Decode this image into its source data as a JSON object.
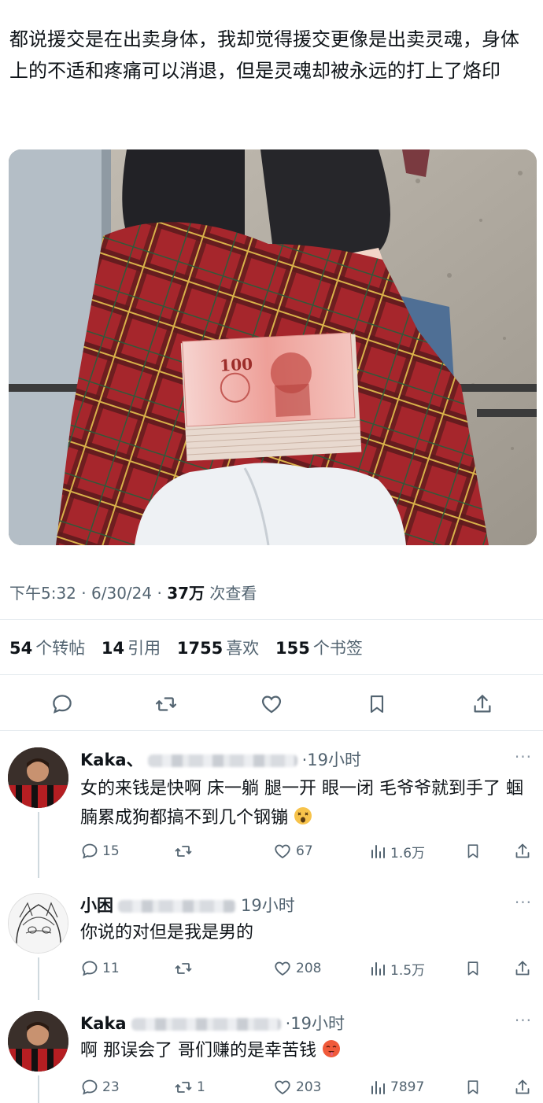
{
  "post": {
    "text": "都说援交是在出卖身体，我却觉得援交更像是出卖灵魂，身体上的不适和疼痛可以消退，但是灵魂却被永远的打上了烙印",
    "banknote_value": "100",
    "time": "下午5:32",
    "date": "6/30/24",
    "views_count": "37万",
    "views_label": "次查看"
  },
  "stats": {
    "retweets": "54",
    "retweets_label": "个转帖",
    "quotes": "14",
    "quotes_label": "引用",
    "likes": "1755",
    "likes_label": "喜欢",
    "bookmarks": "155",
    "bookmarks_label": "个书签"
  },
  "actions": [
    "reply-icon",
    "retweet-icon",
    "like-icon",
    "bookmark-icon",
    "share-icon"
  ],
  "replies": [
    {
      "name": "Kaka、",
      "time": "·19小时",
      "text": "女的来钱是快啊 床一躺 腿一开 眼一闭 毛爷爷就到手了 蝈腩累成狗都搞不到几个钢镚",
      "emoji": "dizzy-face-emoji",
      "replies": "15",
      "retweets": "",
      "likes": "67",
      "views": "1.6万"
    },
    {
      "name": "小困",
      "time": "19小时",
      "text": "你说的对但是我是男的",
      "emoji": "",
      "replies": "11",
      "retweets": "",
      "likes": "208",
      "views": "1.5万"
    },
    {
      "name": "Kaka",
      "time": "·19小时",
      "text": "啊 那误会了 哥们赚的是幸苦钱",
      "emoji": "hot-face-emoji",
      "replies": "23",
      "retweets": "1",
      "likes": "203",
      "views": "7897"
    }
  ],
  "more_label": "···",
  "colors": {
    "text": "#0f1419",
    "secondary": "#536471",
    "divider": "#e6ecf0"
  }
}
